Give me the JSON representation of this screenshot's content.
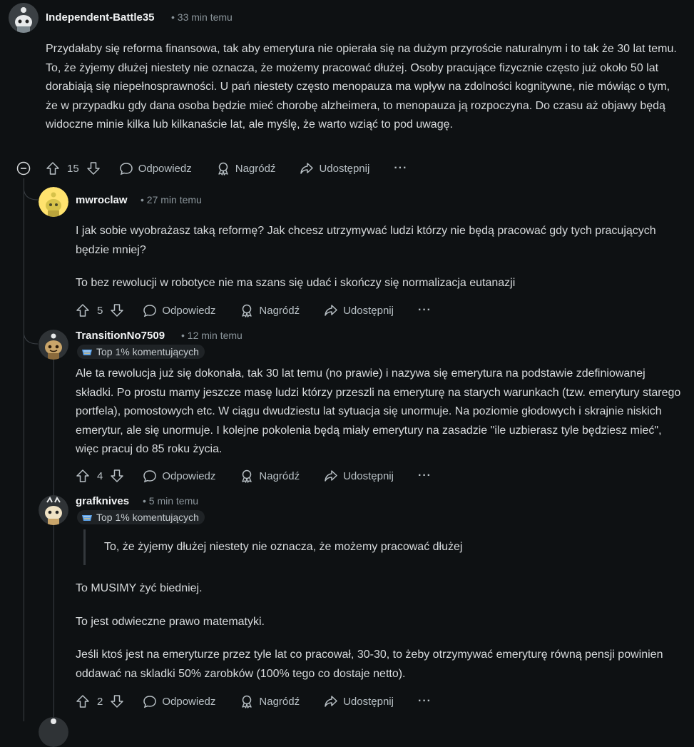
{
  "comments": [
    {
      "username": "Independent-Battle35",
      "time": "33 min temu",
      "body": [
        "Przydałaby się reforma finansowa, tak aby emerytura nie opierała się na dużym przyroście naturalnym i to tak że 30 lat temu. To, że żyjemy dłużej niestety nie oznacza, że możemy pracować dłużej. Osoby pracujące fizycznie często już około 50 lat dorabiają się niepełnosprawności. U pań niestety często menopauza ma wpływ na zdolności kognitywne, nie mówiąc o tym, że w przypadku gdy dana osoba będzie mieć chorobę alzheimera, to menopauza ją rozpoczyna. Do czasu aż objawy będą widoczne minie kilka lub kilkanaście lat, ale myślę, że warto wziąć to pod uwagę."
      ],
      "votes": "15"
    },
    {
      "username": "mwroclaw",
      "time": "27 min temu",
      "body": [
        "I jak sobie wyobrażasz taką reformę? Jak chcesz utrzymywać ludzi którzy nie będą pracować gdy tych pracujących będzie mniej?",
        "To bez rewolucji w robotyce nie ma szans się udać i skończy się normalizacja eutanazji"
      ],
      "votes": "5"
    },
    {
      "username": "TransitionNo7509",
      "time": "12 min temu",
      "badge": "Top 1% komentujących",
      "body": [
        "Ale ta rewolucja już się dokonała, tak 30 lat temu (no prawie) i nazywa się emerytura na podstawie zdefiniowanej składki. Po prostu mamy jeszcze masę ludzi którzy przeszli na emeryturę na starych warunkach (tzw. emerytury starego portfela), pomostowych etc. W ciągu dwudziestu lat sytuacja się unormuje. Na poziomie głodowych i skrajnie niskich emerytur, ale się unormuje. I kolejne pokolenia będą miały emerytury na zasadzie \"ile uzbierasz tyle będziesz mieć\", więc pracuj do 85 roku życia."
      ],
      "votes": "4"
    },
    {
      "username": "grafknives",
      "time": "5 min temu",
      "badge": "Top 1% komentujących",
      "quote": "To, że żyjemy dłużej niestety nie oznacza, że możemy pracować dłużej",
      "body": [
        "To MUSIMY żyć biedniej.",
        "To jest odwieczne prawo matematyki.",
        "Jeśli ktoś jest na emeryturze przez tyle lat co pracował, 30-30, to żeby otrzymywać emeryturę równą pensji powinien oddawać na skladki 50% zarobków (100% tego co dostaje netto)."
      ],
      "votes": "2"
    }
  ],
  "actions": {
    "reply": "Odpowiedz",
    "award": "Nagródź",
    "share": "Udostępnij",
    "more": "···"
  },
  "icons": {
    "collapse": "collapse-minus-icon",
    "upvote": "upvote-arrow-icon",
    "downvote": "downvote-arrow-icon",
    "reply": "speech-bubble-icon",
    "award": "award-ribbon-icon",
    "share": "share-arrow-icon"
  },
  "colors": {
    "background": "#0e1113",
    "text": "#d7dadc",
    "muted": "#8b959b",
    "thread_line": "#3a3f44"
  }
}
